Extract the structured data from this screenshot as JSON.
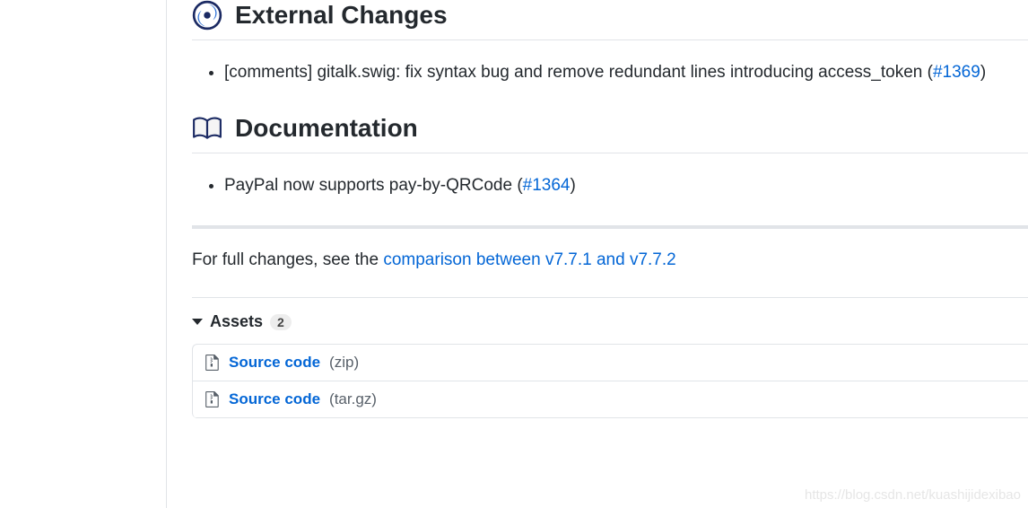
{
  "sections": {
    "external": {
      "title": "External Changes",
      "items": [
        {
          "text_before": "[comments] gitalk.swig: fix syntax bug and remove redundant lines introducing access_token (",
          "link_label": "#1369",
          "text_after": ")"
        }
      ]
    },
    "documentation": {
      "title": "Documentation",
      "items": [
        {
          "text_before": "PayPal now supports pay-by-QRCode (",
          "link_label": "#1364",
          "text_after": ")"
        }
      ]
    }
  },
  "full_changes": {
    "prefix": "For full changes, see the ",
    "link_label": "comparison between v7.7.1 and v7.7.2"
  },
  "assets": {
    "label": "Assets",
    "count": "2",
    "items": [
      {
        "name": "Source code",
        "ext": "(zip)"
      },
      {
        "name": "Source code",
        "ext": "(tar.gz)"
      }
    ]
  },
  "watermark": "https://blog.csdn.net/kuashijidexibao"
}
